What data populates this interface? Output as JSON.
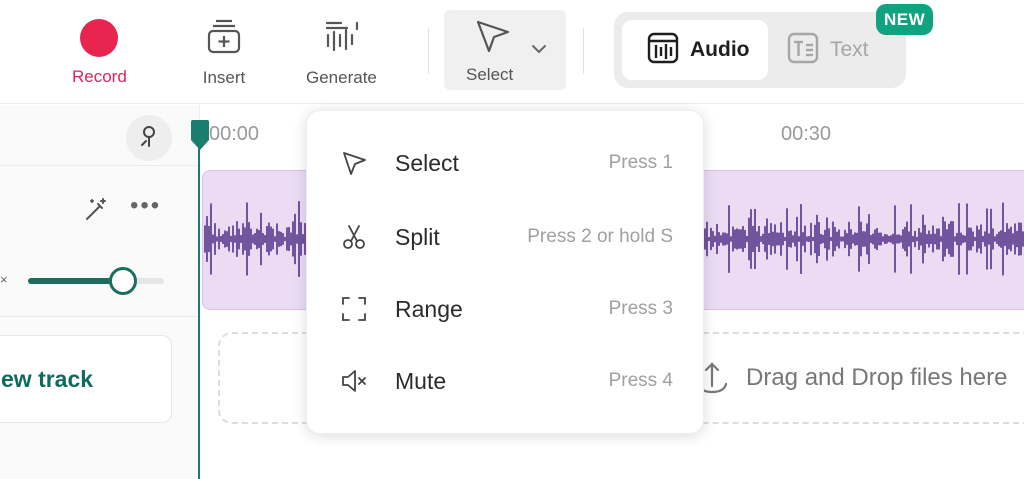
{
  "toolbar": {
    "record_label": "Record",
    "insert_label": "Insert",
    "generate_label": "Generate",
    "select_label": "Select",
    "mode_audio_label": "Audio",
    "mode_text_label": "Text",
    "new_badge": "NEW"
  },
  "colors": {
    "record": "#e8244f",
    "accent": "#1b6e5f",
    "clip_bg": "#ebdcf4",
    "waveform": "#3f1a7a",
    "badge": "#10a37f"
  },
  "timeline": {
    "ticks": [
      "00:00",
      "00:30"
    ],
    "drop_text": "Drag and Drop files here"
  },
  "track": {
    "volume_fraction": 0.7,
    "new_track_label": "ew track"
  },
  "select_menu": {
    "items": [
      {
        "label": "Select",
        "shortcut": "Press 1",
        "icon": "cursor-icon"
      },
      {
        "label": "Split",
        "shortcut": "Press 2 or hold S",
        "icon": "scissors-icon"
      },
      {
        "label": "Range",
        "shortcut": "Press 3",
        "icon": "range-icon"
      },
      {
        "label": "Mute",
        "shortcut": "Press 4",
        "icon": "mute-icon"
      }
    ]
  }
}
